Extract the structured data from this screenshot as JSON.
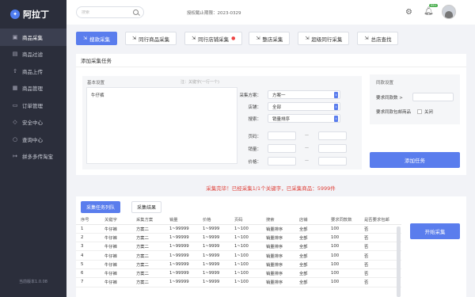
{
  "app": {
    "logo_text": "阿拉丁",
    "version": "当前版本1.0.08"
  },
  "sidebar": {
    "items": [
      {
        "label": "商品采集",
        "icon": "box-icon",
        "glyph": "▣",
        "active": true
      },
      {
        "label": "商品过滤",
        "icon": "filter-icon",
        "glyph": "▤",
        "active": false
      },
      {
        "label": "商品上传",
        "icon": "upload-icon",
        "glyph": "⇧",
        "active": false
      },
      {
        "label": "商品管理",
        "icon": "grid-icon",
        "glyph": "▦",
        "active": false
      },
      {
        "label": "订单管理",
        "icon": "doc-icon",
        "glyph": "▭",
        "active": false
      },
      {
        "label": "安全中心",
        "icon": "shield-icon",
        "glyph": "◇",
        "active": false
      },
      {
        "label": "查询中心",
        "icon": "search-icon",
        "glyph": "○",
        "active": false
      },
      {
        "label": "拼多多传淘宝",
        "icon": "transfer-icon",
        "glyph": "↦",
        "active": false
      }
    ]
  },
  "header": {
    "search_placeholder": "搜索",
    "auth_text": "授权截止期限：2023-0329",
    "notification_count": "99+"
  },
  "tabs": [
    {
      "label": "搜款采集",
      "active": true
    },
    {
      "label": "同行商品采集",
      "active": false
    },
    {
      "label": "同行店铺采集",
      "active": false,
      "hot": true
    },
    {
      "label": "整店采集",
      "active": false
    },
    {
      "label": "超级同行采集",
      "active": false
    },
    {
      "label": "总店查找",
      "active": false
    }
  ],
  "task": {
    "title": "添加采集任务",
    "basic_label": "基本设置",
    "hint": "注：关键字(一行一个)",
    "keyword": "牛仔裤",
    "form": {
      "scheme_label": "采集方案：",
      "scheme_value": "方案一",
      "shop_label": "店铺：",
      "shop_value": "全部",
      "sort_label": "搜索：",
      "sort_value": "销量排序",
      "page_label": "页码：",
      "sales_label": "销量：",
      "price_label": "价格：",
      "range_dash": "—"
    },
    "same": {
      "title": "同款设置",
      "count_label": "要求同款数 >",
      "free_label": "要求同款包邮商品",
      "close_label": "关闭"
    },
    "add_button": "添加任务"
  },
  "status_text": "采集完毕！已经采集1/1个关键字，已采集商品：5999件",
  "bottom": {
    "tabs": [
      "采集任务列队",
      "采集结果"
    ],
    "start_button": "开始采集",
    "columns": [
      "序号",
      "关键字",
      "采集方案",
      "销量",
      "价格",
      "页码",
      "搜索",
      "店铺",
      "要求同款数",
      "是否要求包邮"
    ],
    "rows": [
      [
        "1",
        "牛仔裤",
        "方案二",
        "1~99999",
        "1~9999",
        "1~100",
        "销量排序",
        "全部",
        "100",
        "否"
      ],
      [
        "2",
        "牛仔裤",
        "方案二",
        "1~99999",
        "1~9999",
        "1~100",
        "销量排序",
        "全部",
        "100",
        "否"
      ],
      [
        "3",
        "牛仔裤",
        "方案二",
        "1~99999",
        "1~9999",
        "1~100",
        "销量排序",
        "全部",
        "100",
        "否"
      ],
      [
        "4",
        "牛仔裤",
        "方案二",
        "1~99999",
        "1~9999",
        "1~100",
        "销量排序",
        "全部",
        "100",
        "否"
      ],
      [
        "5",
        "牛仔裤",
        "方案二",
        "1~99999",
        "1~9999",
        "1~100",
        "销量排序",
        "全部",
        "100",
        "否"
      ],
      [
        "6",
        "牛仔裤",
        "方案二",
        "1~99999",
        "1~9999",
        "1~100",
        "销量排序",
        "全部",
        "100",
        "否"
      ],
      [
        "7",
        "牛仔裤",
        "方案二",
        "1~99999",
        "1~9999",
        "1~100",
        "销量排序",
        "全部",
        "100",
        "否"
      ]
    ]
  },
  "colors": {
    "accent": "#5a7ded",
    "sidebar": "#2b2e3b",
    "danger": "#e0413a"
  }
}
